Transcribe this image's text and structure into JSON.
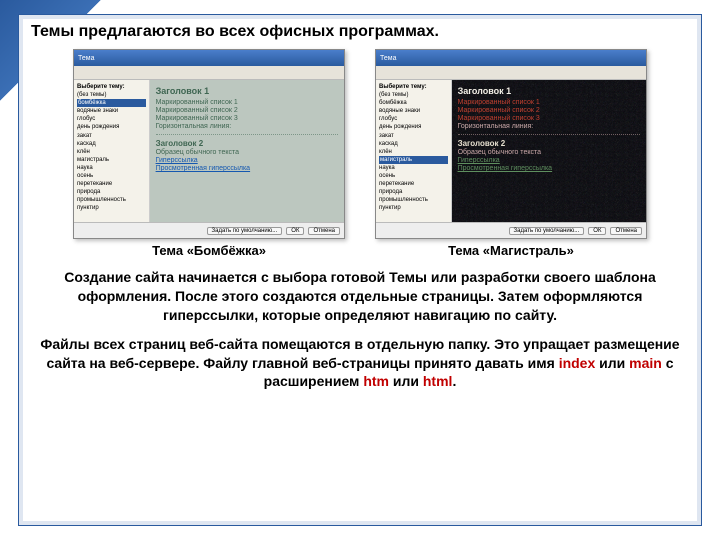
{
  "title": "Темы предлагаются во всех офисных программах.",
  "shots": [
    {
      "caption": "Тема «Бомбёжка»",
      "win_title": "Тема",
      "side_header": "Выберите тему:",
      "side_items": [
        "(без темы)",
        "бомбёжка",
        "водяные знаки",
        "глобус",
        "день рождения",
        "закат",
        "каскад",
        "клён",
        "магистраль",
        "наука",
        "осень",
        "перетекание",
        "природа",
        "промышленность",
        "пунктир"
      ],
      "side_sel_index": 1,
      "preview": {
        "h1": "Заголовок 1",
        "b1": "Маркированный список 1",
        "b2": "Маркированный список 2",
        "b3": "Маркированный список 3",
        "hr": "Горизонтальная линия:",
        "h2": "Заголовок 2",
        "txt": "Образец обычного текста",
        "lnk": "Гиперссылка",
        "lnk2": "Просмотренная гиперссылка"
      },
      "btn_apply": "Задать по умолчанию...",
      "btn_ok": "ОК",
      "btn_cancel": "Отмена"
    },
    {
      "caption": "Тема «Магистраль»",
      "win_title": "Тема",
      "side_header": "Выберите тему:",
      "side_items": [
        "(без темы)",
        "бомбёжка",
        "водяные знаки",
        "глобус",
        "день рождения",
        "закат",
        "каскад",
        "клён",
        "магистраль",
        "наука",
        "осень",
        "перетекание",
        "природа",
        "промышленность",
        "пунктир"
      ],
      "side_sel_index": 8,
      "preview": {
        "h1": "Заголовок 1",
        "b1": "Маркированный список 1",
        "b2": "Маркированный список 2",
        "b3": "Маркированный список 3",
        "hr": "Горизонтальная линия:",
        "h2": "Заголовок 2",
        "txt": "Образец обычного текста",
        "lnk": "Гиперссылка",
        "lnk2": "Просмотренная гиперссылка"
      },
      "btn_apply": "Задать по умолчанию...",
      "btn_ok": "ОК",
      "btn_cancel": "Отмена"
    }
  ],
  "para1": "Создание сайта начинается с выбора готовой Темы или разработки своего шаблона оформления. После этого создаются отдельные страницы. Затем оформляются гиперссылки, которые определяют навигацию по сайту.",
  "para2_a": "Файлы всех страниц веб-сайта помещаются в отдельную папку. Это упращает размещение сайта на веб-сервере. Файлу главной веб-страницы принято давать имя ",
  "kw_index": "index",
  "para2_b": " или ",
  "kw_main": "main",
  "para2_c": " с расширением ",
  "kw_htm": "htm",
  "para2_d": " или ",
  "kw_html": "html",
  "para2_e": "."
}
